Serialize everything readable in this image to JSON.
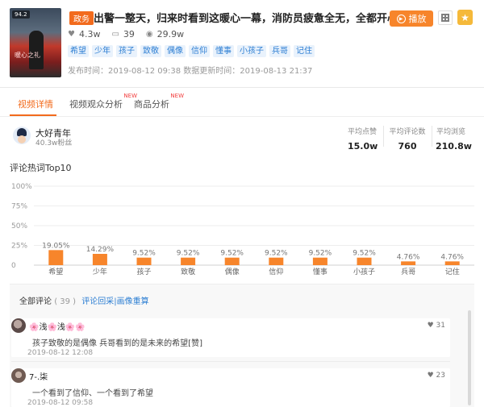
{
  "video": {
    "thumbnail_badge": "94.2",
    "thumbnail_caption": "暖心之礼",
    "genre_tag": "政务",
    "title": "出警一整天，归来时看到这暖心一幕，消防员疲惫全无，全都开心的...",
    "stats": {
      "likes": "4.3w",
      "comments": "39",
      "views": "29.9w"
    },
    "tags": [
      "希望",
      "少年",
      "孩子",
      "致敬",
      "偶像",
      "信仰",
      "懂事",
      "小孩子",
      "兵哥",
      "记住"
    ],
    "publish_time": "发布时间：2019-08-12 09:38 数据更新时间：2019-08-13 21:37",
    "play_label": "播放"
  },
  "colors": {
    "accent": "#f26b1d",
    "tag_blue": "#2e7fd3",
    "bar": "#f7852b",
    "star": "#f5b93a"
  },
  "icons": {
    "likes": "heart-icon",
    "comments": "comment-icon",
    "views": "eye-icon",
    "play": "play-circle-icon",
    "qr": "qr-code-icon",
    "favorite": "star-icon"
  },
  "tabs": [
    {
      "label": "视频详情",
      "active": true,
      "new": ""
    },
    {
      "label": "视频观众分析",
      "active": false,
      "new": "NEW"
    },
    {
      "label": "商品分析",
      "active": false,
      "new": "NEW"
    }
  ],
  "author": {
    "name": "大好青年",
    "fans": "40.3w粉丝"
  },
  "metrics": [
    {
      "label": "平均点赞",
      "value": "15.0w"
    },
    {
      "label": "平均评论数",
      "value": "760"
    },
    {
      "label": "平均浏览",
      "value": "210.8w"
    }
  ],
  "chart_title": "评论热词Top10",
  "chart_data": {
    "type": "bar",
    "title": "评论热词Top10",
    "categories": [
      "希望",
      "少年",
      "孩子",
      "致敬",
      "偶像",
      "信仰",
      "懂事",
      "小孩子",
      "兵哥",
      "记住"
    ],
    "values": [
      19.05,
      14.29,
      9.52,
      9.52,
      9.52,
      9.52,
      9.52,
      9.52,
      4.76,
      4.76
    ],
    "value_labels": [
      "19.05%",
      "14.29%",
      "9.52%",
      "9.52%",
      "9.52%",
      "9.52%",
      "9.52%",
      "9.52%",
      "4.76%",
      "4.76%"
    ],
    "ytick_labels": [
      "100%",
      "75%",
      "50%",
      "25%",
      "0"
    ],
    "ylim": [
      0,
      100
    ],
    "grid": true
  },
  "comments": {
    "header_label": "全部评论",
    "count": "( 39 )",
    "link": "评论回采|画像重算",
    "items": [
      {
        "user": "🌸浅🌸浅🌸🌸",
        "text": "孩子致敬的是偶像 兵哥看到的是未来的希望[赞]",
        "time": "2019-08-12 12:08",
        "likes": "31"
      },
      {
        "user": "7-.柒",
        "text": "一个看到了信仰、一个看到了希望",
        "time": "2019-08-12 09:58",
        "likes": "23"
      }
    ]
  }
}
